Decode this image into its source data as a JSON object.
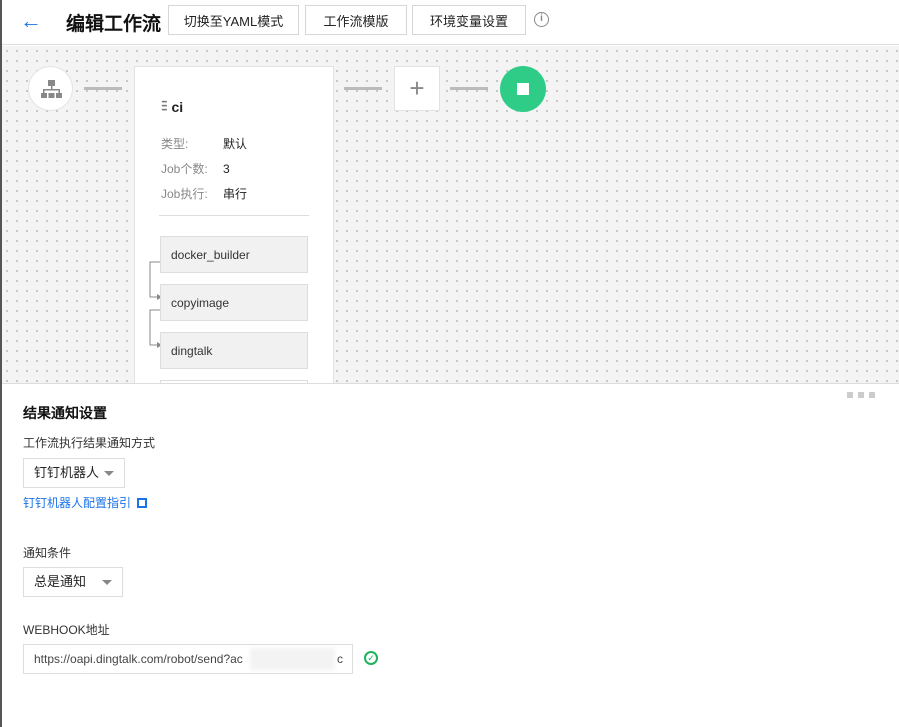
{
  "header": {
    "title": "编辑工作流",
    "buttons": [
      "切换至YAML模式",
      "工作流模版",
      "环境变量设置"
    ],
    "info_icon": "i"
  },
  "stage": {
    "name": "ci",
    "rows": [
      {
        "k": "类型:",
        "v": "默认"
      },
      {
        "k": "Job个数:",
        "v": "3"
      },
      {
        "k": "Job执行:",
        "v": "串行"
      }
    ],
    "jobs": [
      "docker_builder",
      "copyimage",
      "dingtalk"
    ],
    "add": "+"
  },
  "colors": {
    "accent": "#1a73e8",
    "end": "#2ecc87",
    "ok": "#1fb35a"
  },
  "panel": {
    "title": "结果通知设置",
    "method_label": "工作流执行结果通知方式",
    "method_value": "钉钉机器人",
    "guide_link": "钉钉机器人配置指引",
    "condition_label": "通知条件",
    "condition_value": "总是通知",
    "webhook_label": "WEBHOOK地址",
    "webhook_value": "https://oapi.dingtalk.com/robot/send?ac",
    "webhook_tail": "c"
  }
}
